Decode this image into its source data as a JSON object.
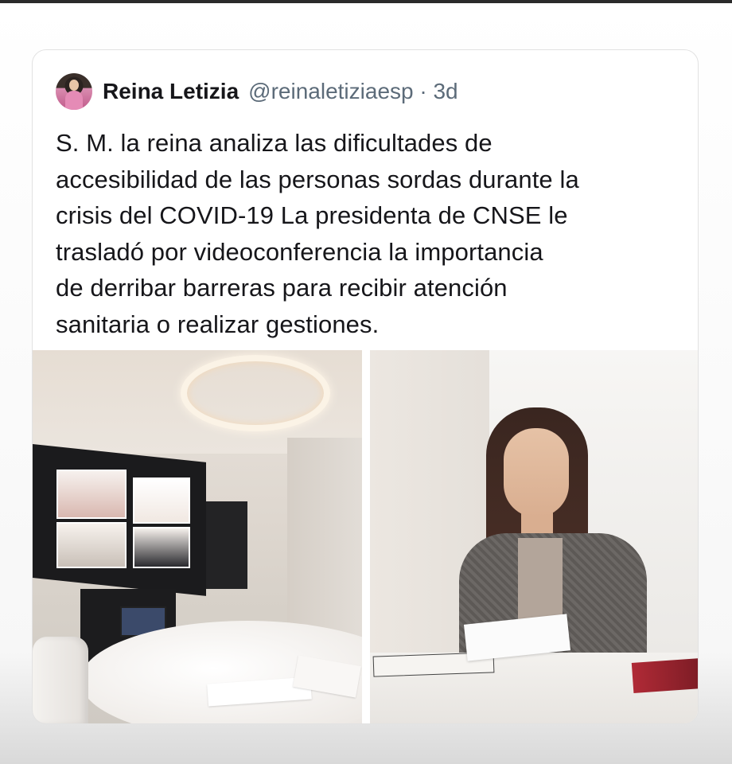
{
  "tweet": {
    "author": {
      "display_name": "Reina Letizia",
      "handle": "@reinaletiziaesp",
      "separator": "·",
      "time_ago": "3d"
    },
    "text_lines": [
      "S. M. la reina analiza las dificultades de",
      "accesibilidad de las personas sordas durante la",
      "crisis del COVID-19 La presidenta de CNSE le",
      "trasladó por videoconferencia la importancia",
      "de derribar barreras para recibir atención",
      "sanitaria o realizar gestiones."
    ]
  },
  "colors": {
    "text_primary": "#16161a",
    "text_secondary": "#5c6b79",
    "card_border": "#e2e2e2"
  }
}
